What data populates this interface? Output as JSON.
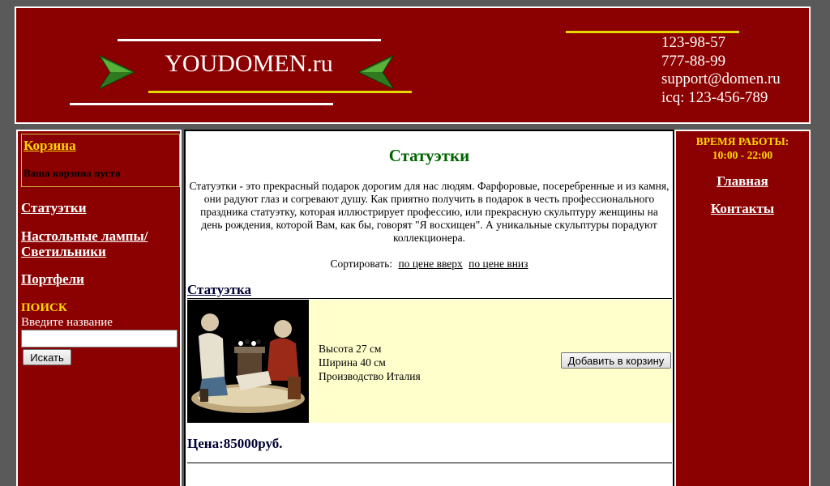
{
  "header": {
    "logo": "YOUDOMEN.ru",
    "contacts": [
      "123-98-57",
      "777-88-99",
      "support@domen.ru",
      "icq: 123-456-789"
    ]
  },
  "sidebar": {
    "cart_title": "Корзина",
    "cart_status": "Ваша корзина пуста",
    "nav": [
      {
        "label": "Статуэтки"
      },
      {
        "label": "Настольные лампы/"
      },
      {
        "label": "Светильники"
      },
      {
        "label": "Портфели"
      }
    ],
    "search_title": "ПОИСК",
    "search_hint": "Введите название",
    "search_value": "",
    "search_button": "Искать"
  },
  "main": {
    "title": "Статуэтки",
    "intro": "Статуэтки - это прекрасный подарок дорогим для нас людям. Фарфоровые, посеребренные и из камня, они радуют глаз и согревают душу. Как приятно получить в подарок в честь профессионального праздника статуэтку, которая иллюстрирует профессию, или прекрасную скульптуру женщины на день рождения, которой Вам, как бы, говорят \"Я восхищен\". А уникальные скульптуры порадуют коллекционера.",
    "sort_label": "Сортировать:",
    "sort_up": "по цене вверх",
    "sort_down": "по цене вниз",
    "product": {
      "title": "Статуэтка",
      "height": "Высота 27 см",
      "width": "Ширина 40 см",
      "origin": "Производство Италия",
      "add_button": "Добавить в корзину",
      "price": "Цена:85000руб."
    }
  },
  "right": {
    "hours_label": "ВРЕМЯ РАБОТЫ:",
    "hours_value": "10:00 - 22:00",
    "nav": [
      {
        "label": "Главная"
      },
      {
        "label": "Контакты"
      }
    ]
  },
  "colors": {
    "brand": "#8b0000",
    "accent": "#ffd700",
    "title_green": "#006400",
    "product_bg": "#ffffcc"
  }
}
